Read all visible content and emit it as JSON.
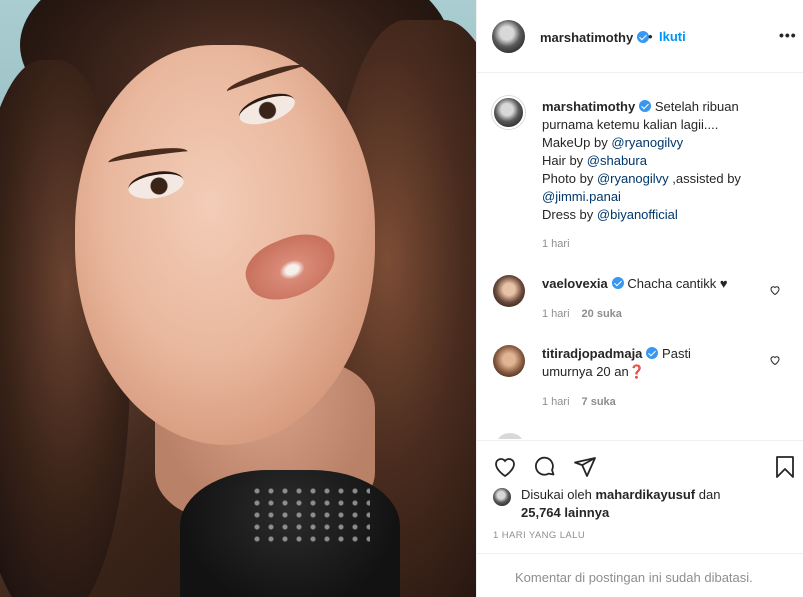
{
  "header": {
    "username": "marshatimothy",
    "separator": "•",
    "follow_label": "Ikuti",
    "more_label": "•••"
  },
  "caption": {
    "username": "marshatimothy",
    "line1": "Setelah ribuan",
    "line2": "purnama ketemu kalian lagii....",
    "makeup_prefix": "MakeUp by ",
    "makeup_tag": "@ryanogilvy",
    "hair_prefix": "Hair by ",
    "hair_tag": "@shabura",
    "photo_prefix": "Photo by ",
    "photo_tag": "@ryanogilvy",
    "assisted": " ,assisted by",
    "assist_tag": "@jimmi.panai",
    "dress_prefix": "Dress by ",
    "dress_tag": "@biyanofficial",
    "time": "1 hari"
  },
  "comments": [
    {
      "username": "vaelovexia",
      "text": "Chacha cantikk ♥",
      "time": "1 hari",
      "likes": "20 suka"
    },
    {
      "username": "titiradjopadmaja",
      "text_line1": "Pasti",
      "text_line2": "umurnya 20 an❓",
      "time": "1 hari",
      "likes": "7 suka"
    }
  ],
  "likes": {
    "prefix": "Disukai oleh ",
    "user": "mahardikayusuf",
    "suffix": " dan",
    "count": "25,764 lainnya"
  },
  "date": "1 HARI YANG LALU",
  "footer": "Komentar di postingan ini sudah dibatasi.",
  "colors": {
    "accent": "#0095f6",
    "verified": "#3897f0",
    "muted": "#8e8e8e",
    "tag": "#00376b"
  }
}
